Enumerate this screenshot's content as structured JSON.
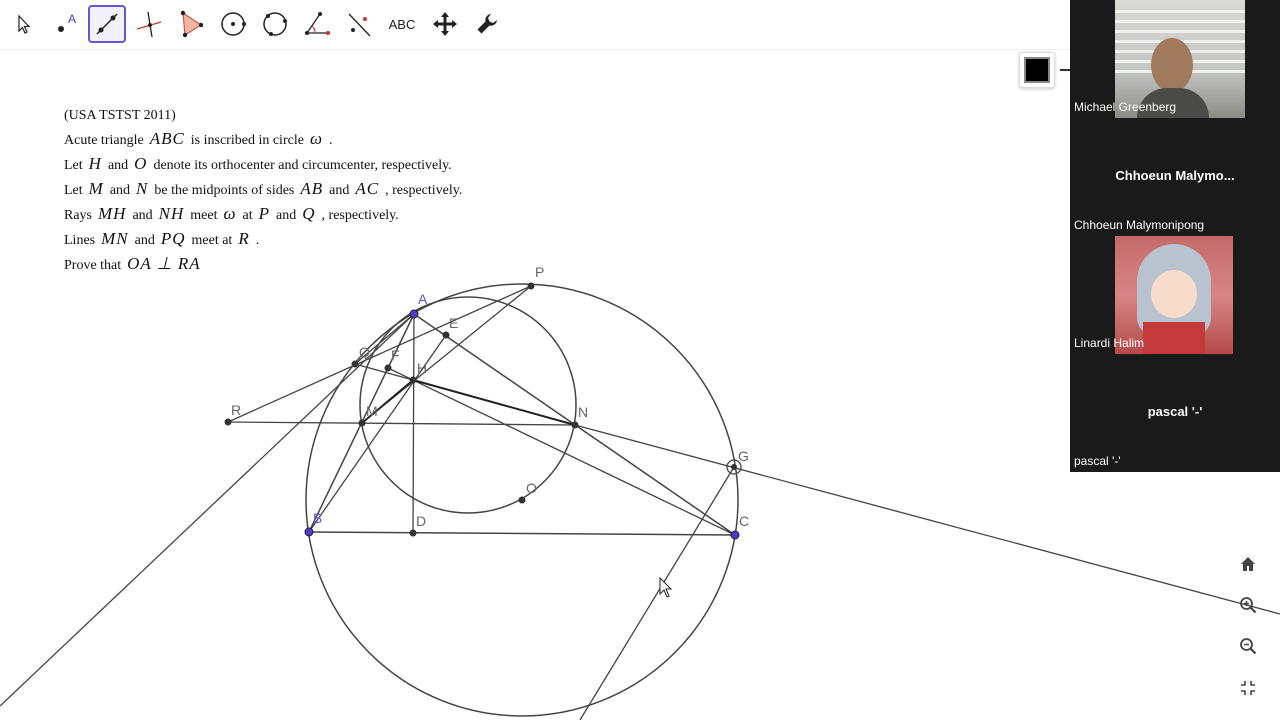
{
  "toolbar": {
    "tools": [
      {
        "name": "Move"
      },
      {
        "name": "Point"
      },
      {
        "name": "Line",
        "active": true
      },
      {
        "name": "Perpendicular Line"
      },
      {
        "name": "Polygon"
      },
      {
        "name": "Circle with Center"
      },
      {
        "name": "Circle through 3 Points"
      },
      {
        "name": "Angle"
      },
      {
        "name": "Reflect about Line"
      },
      {
        "name": "Text",
        "label": "ABC"
      },
      {
        "name": "Move Graphics View"
      },
      {
        "name": "Tools"
      }
    ]
  },
  "problem": {
    "title": "(USA TSTST 2011)",
    "lines": [
      {
        "t1": "Acute triangle",
        "m1": "ABC",
        "t2": "is inscribed in circle",
        "m2": "ω",
        "t3": "."
      },
      {
        "t1": "Let",
        "m1": "H",
        "t2": "and",
        "m2": "O",
        "t3": "denote its orthocenter and circumcenter, respectively."
      },
      {
        "t1": "Let",
        "m1": "M",
        "t2": "and",
        "m2": "N",
        "t3": "be the midpoints of sides",
        "m3": "AB",
        "t4": "and",
        "m4": "AC",
        "t5": ", respectively."
      },
      {
        "t1": "Rays",
        "m1": "MH",
        "t2": "and",
        "m2": "NH",
        "t3": "meet",
        "m3": "ω",
        "t4": "at",
        "m4": "P",
        "t5": "and",
        "m5": "Q",
        "t6": ", respectively."
      },
      {
        "t1": "Lines",
        "m1": "MN",
        "t2": "and",
        "m2": "PQ",
        "t3": "meet at",
        "m3": "R",
        "t4": "."
      },
      {
        "t1": "Prove that",
        "m1": "OA ⊥ RA"
      }
    ]
  },
  "geometry": {
    "point_labels": [
      "A",
      "B",
      "C",
      "D",
      "E",
      "F",
      "H",
      "M",
      "N",
      "O",
      "P",
      "Q",
      "R",
      "G"
    ],
    "colors": {
      "free_point": "#4b3bd0",
      "dependent_point": "#333333",
      "line": "#444444",
      "label": "#555555",
      "label_blue": "#5a55cc"
    }
  },
  "participants": [
    {
      "name": "Michael Greenberg",
      "type": "video"
    },
    {
      "name": "Chhoeun Malymonipong",
      "display": "Chhoeun  Malymo...",
      "type": "name"
    },
    {
      "name": "Linardi Halim",
      "type": "avatar"
    },
    {
      "name": "pascal '-'",
      "display": "pascal '-'",
      "type": "name"
    }
  ],
  "view_controls": [
    "home-icon",
    "zoom-in-icon",
    "zoom-out-icon",
    "fullscreen-icon"
  ]
}
